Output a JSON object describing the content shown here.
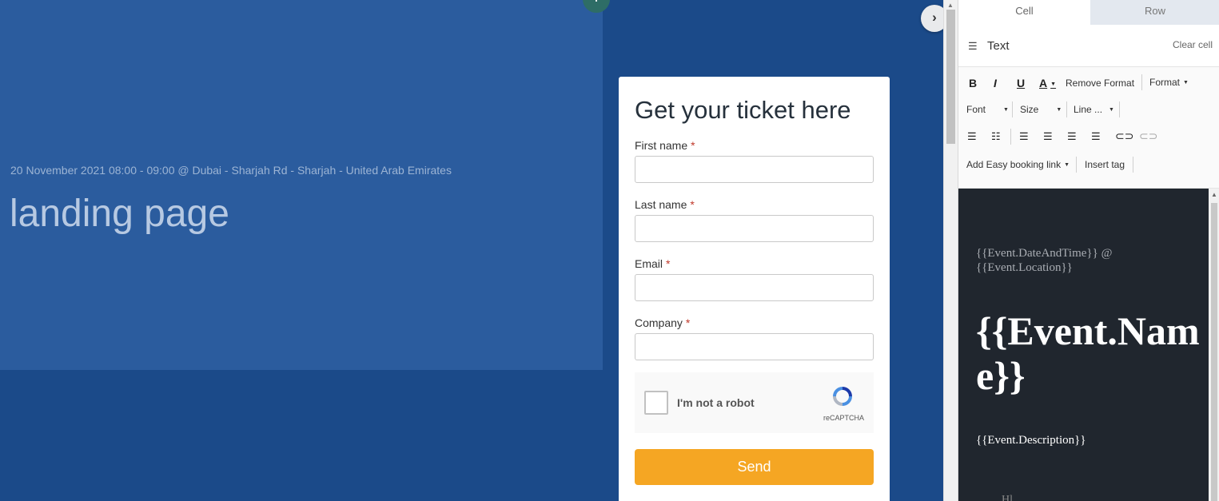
{
  "canvas": {
    "hero_meta": "20 November 2021 08:00 - 09:00 @ Dubai - Sharjah Rd - Sharjah - United Arab Emirates",
    "hero_title": "landing page",
    "add_icon": "+",
    "expand_icon": "›"
  },
  "form": {
    "title": "Get your ticket here",
    "required_marker": "*",
    "fields": [
      {
        "label": "First name"
      },
      {
        "label": "Last name"
      },
      {
        "label": "Email"
      },
      {
        "label": "Company"
      }
    ],
    "captcha_label": "I'm not a robot",
    "captcha_brand": "reCAPTCHA",
    "submit_label": "Send"
  },
  "panel": {
    "tabs": [
      {
        "label": "Cell"
      },
      {
        "label": "Row"
      }
    ],
    "block_type": "Text",
    "clear_label": "Clear cell",
    "toolbar": {
      "bold": "B",
      "italic": "I",
      "underline": "U",
      "font_color": "A",
      "remove_format": "Remove Format",
      "format": "Format",
      "font": "Font",
      "size": "Size",
      "line": "Line ...",
      "add_booking_link": "Add Easy booking link",
      "insert_tag": "Insert tag"
    },
    "preview": {
      "meta": "{{Event.DateAndTime}} @ {{Event.Location}}",
      "title": "{{Event.Name}}",
      "description": "{{Event.Description}}",
      "partial_text": "... Hl"
    }
  },
  "colors": {
    "canvas_bg": "#1b4a89",
    "hero_bg": "#2b5c9e",
    "send_button": "#f5a623",
    "preview_bg": "#20262e"
  }
}
